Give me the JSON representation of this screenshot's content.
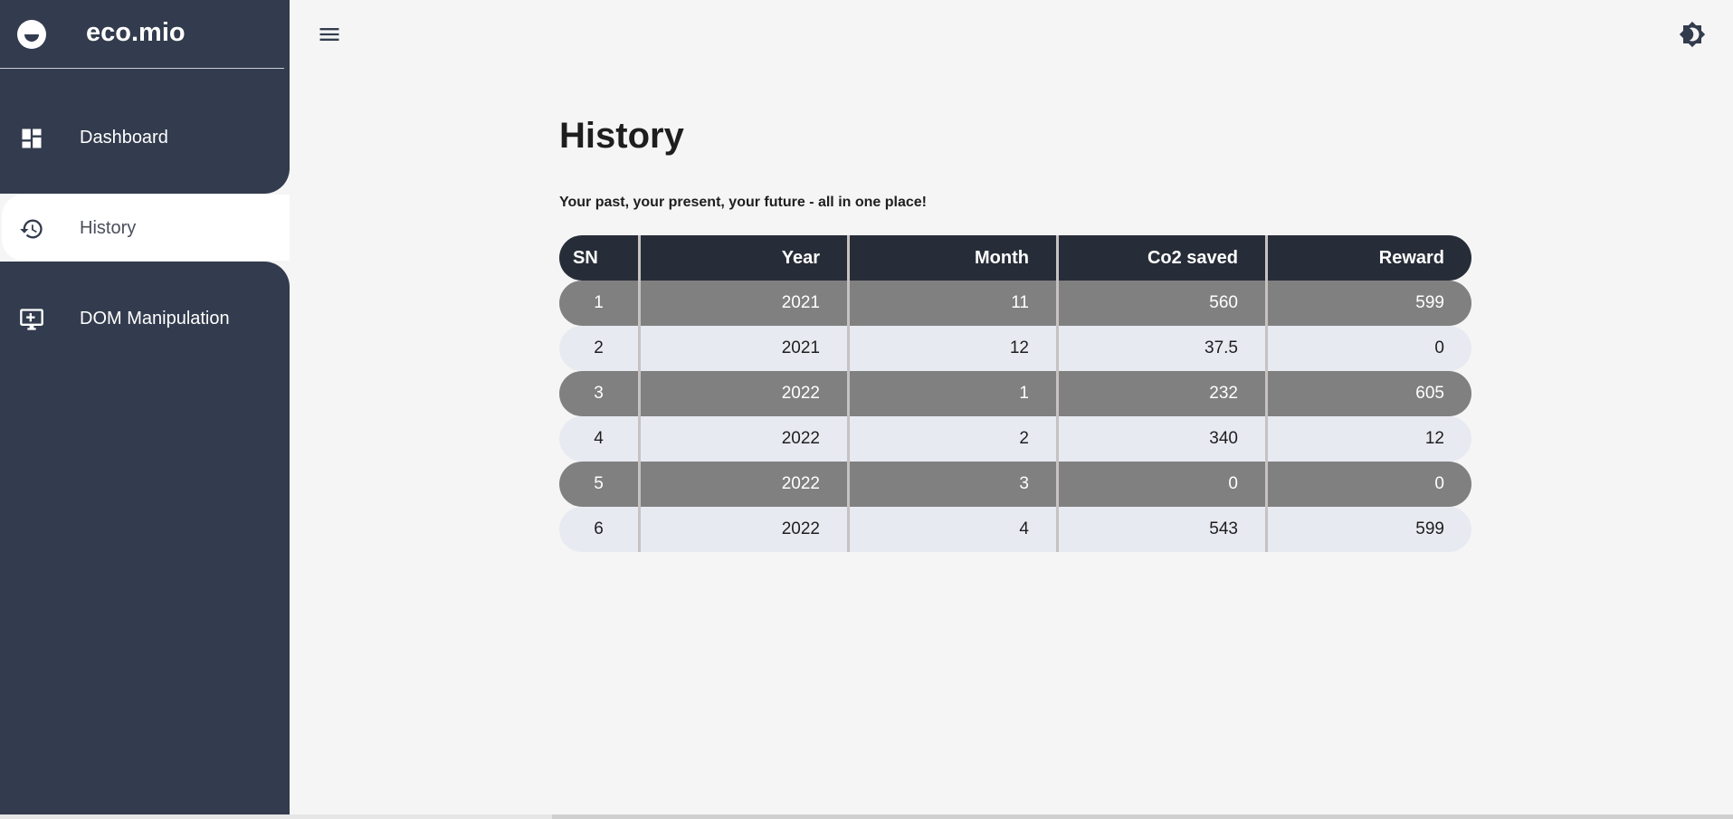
{
  "brand": {
    "name": "eco.mio"
  },
  "sidebar": {
    "items": [
      {
        "label": "Dashboard",
        "icon": "dashboard-icon"
      },
      {
        "label": "History",
        "icon": "history-icon",
        "active": true
      },
      {
        "label": "DOM Manipulation",
        "icon": "monitor-add-icon"
      }
    ]
  },
  "header": {
    "menu_icon": "hamburger-menu-icon",
    "theme_icon": "brightness-icon"
  },
  "main": {
    "title": "History",
    "subtitle": "Your past, your present, your future - all in one place!",
    "table": {
      "headers": [
        "SN",
        "Year",
        "Month",
        "Co2 saved",
        "Reward"
      ],
      "rows": [
        [
          "1",
          "2021",
          "11",
          "560",
          "599"
        ],
        [
          "2",
          "2021",
          "12",
          "37.5",
          "0"
        ],
        [
          "3",
          "2022",
          "1",
          "232",
          "605"
        ],
        [
          "4",
          "2022",
          "2",
          "340",
          "12"
        ],
        [
          "5",
          "2022",
          "3",
          "0",
          "0"
        ],
        [
          "6",
          "2022",
          "4",
          "543",
          "599"
        ]
      ]
    }
  },
  "colors": {
    "sidebar_bg": "#333c4e",
    "header_row_bg": "#272d38",
    "dark_row_bg": "#808080",
    "light_row_bg": "#e8eaf2",
    "page_bg": "#f5f5f5"
  }
}
